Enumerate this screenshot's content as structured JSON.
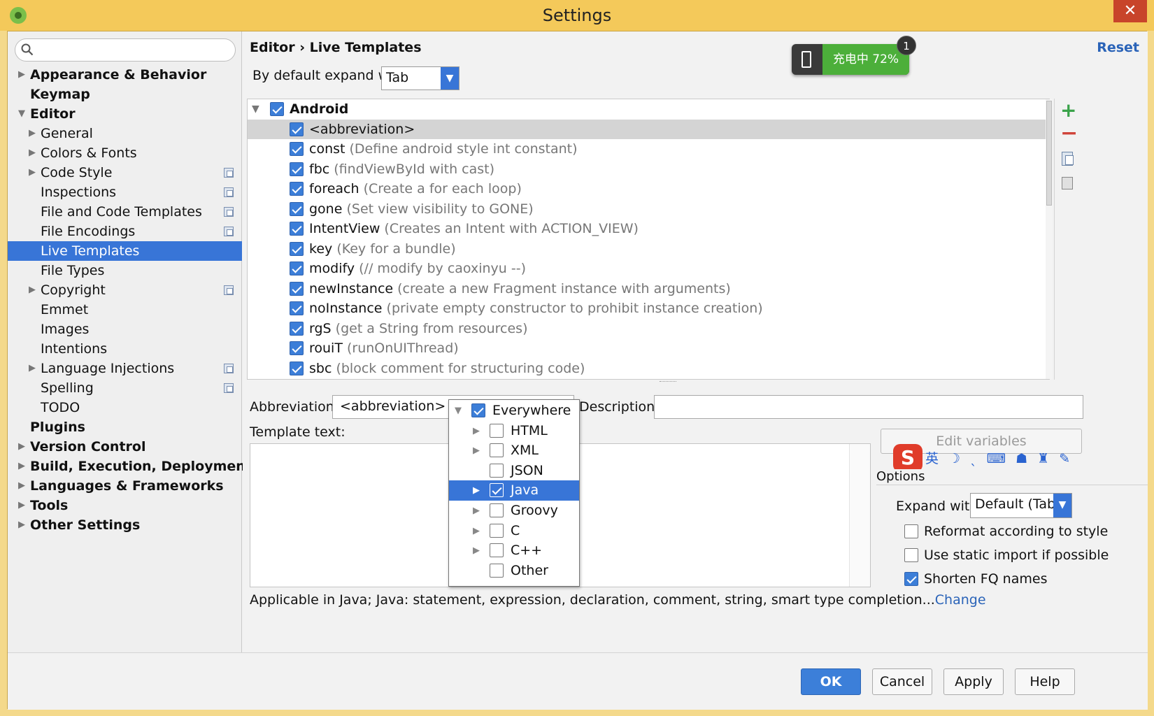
{
  "window": {
    "title": "Settings",
    "close_label": "✕"
  },
  "sidebar": {
    "search_placeholder": "",
    "items": [
      {
        "label": "Appearance & Behavior",
        "bold": true,
        "arrow": "▶",
        "indent": 0
      },
      {
        "label": "Keymap",
        "bold": true,
        "arrow": "",
        "indent": 0
      },
      {
        "label": "Editor",
        "bold": true,
        "arrow": "▼",
        "indent": 0
      },
      {
        "label": "General",
        "bold": false,
        "arrow": "▶",
        "indent": 1
      },
      {
        "label": "Colors & Fonts",
        "bold": false,
        "arrow": "▶",
        "indent": 1
      },
      {
        "label": "Code Style",
        "bold": false,
        "arrow": "▶",
        "indent": 1,
        "copy": true
      },
      {
        "label": "Inspections",
        "bold": false,
        "arrow": "",
        "indent": 1,
        "copy": true
      },
      {
        "label": "File and Code Templates",
        "bold": false,
        "arrow": "",
        "indent": 1,
        "copy": true
      },
      {
        "label": "File Encodings",
        "bold": false,
        "arrow": "",
        "indent": 1,
        "copy": true
      },
      {
        "label": "Live Templates",
        "bold": false,
        "arrow": "",
        "indent": 1,
        "selected": true
      },
      {
        "label": "File Types",
        "bold": false,
        "arrow": "",
        "indent": 1
      },
      {
        "label": "Copyright",
        "bold": false,
        "arrow": "▶",
        "indent": 1,
        "copy": true
      },
      {
        "label": "Emmet",
        "bold": false,
        "arrow": "",
        "indent": 1
      },
      {
        "label": "Images",
        "bold": false,
        "arrow": "",
        "indent": 1
      },
      {
        "label": "Intentions",
        "bold": false,
        "arrow": "",
        "indent": 1
      },
      {
        "label": "Language Injections",
        "bold": false,
        "arrow": "▶",
        "indent": 1,
        "copy": true
      },
      {
        "label": "Spelling",
        "bold": false,
        "arrow": "",
        "indent": 1,
        "copy": true
      },
      {
        "label": "TODO",
        "bold": false,
        "arrow": "",
        "indent": 1
      },
      {
        "label": "Plugins",
        "bold": true,
        "arrow": "",
        "indent": 0
      },
      {
        "label": "Version Control",
        "bold": true,
        "arrow": "▶",
        "indent": 0
      },
      {
        "label": "Build, Execution, Deployment",
        "bold": true,
        "arrow": "▶",
        "indent": 0
      },
      {
        "label": "Languages & Frameworks",
        "bold": true,
        "arrow": "▶",
        "indent": 0
      },
      {
        "label": "Tools",
        "bold": true,
        "arrow": "▶",
        "indent": 0
      },
      {
        "label": "Other Settings",
        "bold": true,
        "arrow": "▶",
        "indent": 0
      }
    ]
  },
  "header": {
    "breadcrumb": "Editor › Live Templates",
    "reset_label": "Reset",
    "expand_label": "By default expand with",
    "expand_value": "Tab"
  },
  "battery": {
    "text": "充电中 72%",
    "badge": "1"
  },
  "templates": {
    "group": "Android",
    "items": [
      {
        "abbr": "<abbreviation>",
        "desc": "",
        "checked": true,
        "selected": true
      },
      {
        "abbr": "const",
        "desc": "(Define android style int constant)",
        "checked": true
      },
      {
        "abbr": "fbc",
        "desc": "(findViewById with cast)",
        "checked": true
      },
      {
        "abbr": "foreach",
        "desc": "(Create a for each loop)",
        "checked": true
      },
      {
        "abbr": "gone",
        "desc": "(Set view visibility to GONE)",
        "checked": true
      },
      {
        "abbr": "IntentView",
        "desc": "(Creates an Intent with ACTION_VIEW)",
        "checked": true
      },
      {
        "abbr": "key",
        "desc": "(Key for a bundle)",
        "checked": true
      },
      {
        "abbr": "modify",
        "desc": "(//  modify by caoxinyu  --)",
        "checked": true
      },
      {
        "abbr": "newInstance",
        "desc": "(create a new Fragment instance with arguments)",
        "checked": true
      },
      {
        "abbr": "noInstance",
        "desc": "(private empty constructor to prohibit instance creation)",
        "checked": true
      },
      {
        "abbr": "rgS",
        "desc": "(get a String from resources)",
        "checked": true
      },
      {
        "abbr": "rouiT",
        "desc": "(runOnUIThread)",
        "checked": true
      },
      {
        "abbr": "sbc",
        "desc": "(block comment for structuring code)",
        "checked": true
      }
    ]
  },
  "editor": {
    "abbreviation_label": "Abbreviation:",
    "abbreviation_value": "<abbreviation>",
    "description_label": "Description:",
    "description_value": "",
    "template_text_label": "Template text:",
    "applicable_text": "Applicable in Java; Java: statement, expression, declaration, comment, string, smart type completion...",
    "change_label": "Change",
    "edit_variables_label": "Edit variables"
  },
  "context_popup": {
    "items": [
      {
        "label": "Everywhere",
        "checked": true,
        "tri": "▼",
        "indent": 0
      },
      {
        "label": "HTML",
        "checked": false,
        "tri": "▶",
        "indent": 1
      },
      {
        "label": "XML",
        "checked": false,
        "tri": "▶",
        "indent": 1
      },
      {
        "label": "JSON",
        "checked": false,
        "tri": "",
        "indent": 1
      },
      {
        "label": "Java",
        "checked": true,
        "tri": "▶",
        "indent": 1,
        "selected": true
      },
      {
        "label": "Groovy",
        "checked": false,
        "tri": "▶",
        "indent": 1
      },
      {
        "label": "C",
        "checked": false,
        "tri": "▶",
        "indent": 1
      },
      {
        "label": "C++",
        "checked": false,
        "tri": "▶",
        "indent": 1
      },
      {
        "label": "Other",
        "checked": false,
        "tri": "",
        "indent": 1
      }
    ]
  },
  "ime_toolbar": {
    "logo": "S",
    "icons": "英 ☽ ˎ ⌨ ☗ ♜ ✎"
  },
  "options": {
    "title": "Options",
    "expand_with_label": "Expand with",
    "expand_with_value": "Default (Tab)",
    "reformat_label": "Reformat according to style",
    "reformat_checked": false,
    "static_import_label": "Use static import if possible",
    "static_import_checked": false,
    "shorten_fq_label": "Shorten FQ names",
    "shorten_fq_checked": true
  },
  "footer": {
    "ok": "OK",
    "cancel": "Cancel",
    "apply": "Apply",
    "help": "Help"
  },
  "colors": {
    "accent": "#3875d7",
    "title_bar": "#f4c95a",
    "link": "#2a63b8"
  }
}
